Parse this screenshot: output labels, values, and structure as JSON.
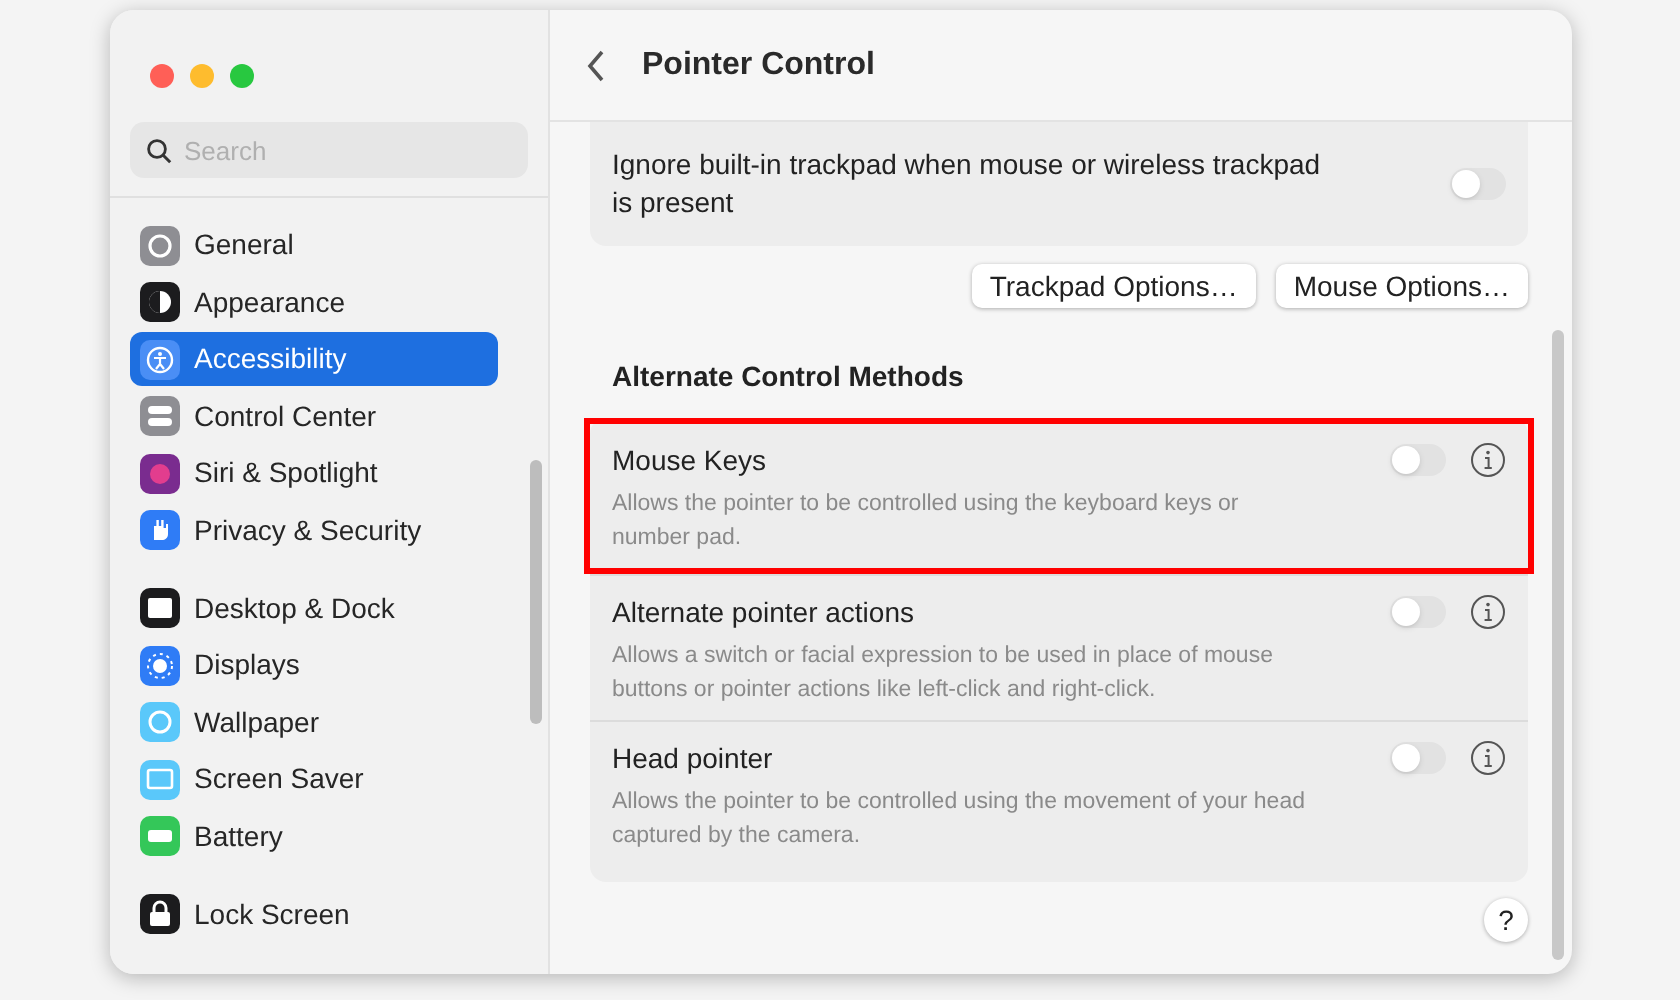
{
  "window": {
    "title": "Pointer Control"
  },
  "sidebar": {
    "search": {
      "placeholder": "Search"
    },
    "groups": [
      {
        "items": [
          {
            "label": "General",
            "kind": "gear",
            "color": "#8e8e93",
            "selected": false
          },
          {
            "label": "Appearance",
            "kind": "appearance",
            "color": "#1c1c1e",
            "selected": false
          },
          {
            "label": "Accessibility",
            "kind": "accessibility",
            "color": "#4a8ef5",
            "selected": true
          },
          {
            "label": "Control Center",
            "kind": "toggles",
            "color": "#8e8e93",
            "selected": false
          },
          {
            "label": "Siri & Spotlight",
            "kind": "siri",
            "color": "#7a2c8f",
            "selected": false
          },
          {
            "label": "Privacy & Security",
            "kind": "hand",
            "color": "#2f7cf6",
            "selected": false
          }
        ]
      },
      {
        "items": [
          {
            "label": "Desktop & Dock",
            "kind": "dock",
            "color": "#1c1c1e",
            "selected": false
          },
          {
            "label": "Displays",
            "kind": "sun",
            "color": "#2f7cf6",
            "selected": false
          },
          {
            "label": "Wallpaper",
            "kind": "flower",
            "color": "#5ac8fa",
            "selected": false
          },
          {
            "label": "Screen Saver",
            "kind": "screen",
            "color": "#5ac8fa",
            "selected": false
          },
          {
            "label": "Battery",
            "kind": "battery",
            "color": "#34c759",
            "selected": false
          }
        ]
      },
      {
        "items": [
          {
            "label": "Lock Screen",
            "kind": "lock",
            "color": "#1c1c1e",
            "selected": false
          }
        ]
      }
    ]
  },
  "trackpad_row": {
    "label": "Ignore built-in trackpad when mouse or wireless trackpad is present",
    "on": false
  },
  "buttons": [
    "Trackpad Options…",
    "Mouse Options…"
  ],
  "section": {
    "title": "Alternate Control Methods",
    "rows": [
      {
        "title": "Mouse Keys",
        "description": "Allows the pointer to be controlled using the keyboard keys or number pad.",
        "on": false,
        "highlighted": true
      },
      {
        "title": "Alternate pointer actions",
        "description": "Allows a switch or facial expression to be used in place of mouse buttons or pointer actions like left-click and right-click.",
        "on": false,
        "highlighted": false
      },
      {
        "title": "Head pointer",
        "description": "Allows the pointer to be controlled using the movement of your head captured by the camera.",
        "on": false,
        "highlighted": false
      }
    ]
  },
  "help": "?"
}
